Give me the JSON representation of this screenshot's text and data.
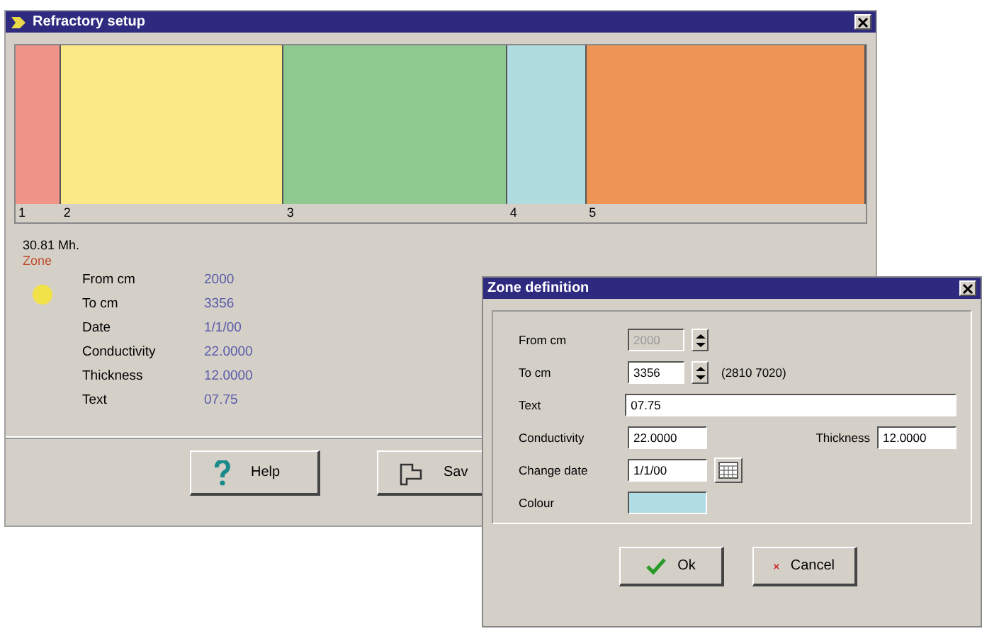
{
  "window": {
    "title": "Refractory setup"
  },
  "zones": [
    {
      "label": "1",
      "color": "#f0948a"
    },
    {
      "label": "2",
      "color": "#fbe985"
    },
    {
      "label": "3",
      "color": "#8ec98f"
    },
    {
      "label": "4",
      "color": "#b0dce0"
    },
    {
      "label": "5",
      "color": "#ee9455"
    }
  ],
  "total": "30.81 Mh.",
  "zone_heading": "Zone",
  "details": [
    {
      "label": "From cm",
      "value": "2000"
    },
    {
      "label": "To cm",
      "value": "3356"
    },
    {
      "label": "Date",
      "value": "1/1/00"
    },
    {
      "label": "Conductivity",
      "value": "22.0000"
    },
    {
      "label": "Thickness",
      "value": "12.0000"
    },
    {
      "label": "Text",
      "value": "07.75"
    }
  ],
  "buttons": [
    {
      "kind": "help",
      "label": "Help"
    },
    {
      "kind": "save",
      "label": "Sav"
    }
  ],
  "dialog": {
    "title": "Zone definition",
    "from": {
      "label": "From cm",
      "value": "2000",
      "disabled": true
    },
    "to": {
      "label": "To cm",
      "value": "3356",
      "range": "(2810 7020)",
      "disabled": false
    },
    "text": {
      "label": "Text",
      "value": "07.75"
    },
    "conductivity": {
      "label": "Conductivity",
      "value": "22.0000"
    },
    "thickness": {
      "label": "Thickness",
      "value": "12.0000"
    },
    "date": {
      "label": "Change date",
      "value": "1/1/00"
    },
    "colour": {
      "label": "Colour",
      "color": "#b0dde4"
    },
    "buttons": [
      {
        "kind": "ok",
        "label": "Ok"
      },
      {
        "kind": "cancel",
        "label": "Cancel"
      }
    ]
  }
}
